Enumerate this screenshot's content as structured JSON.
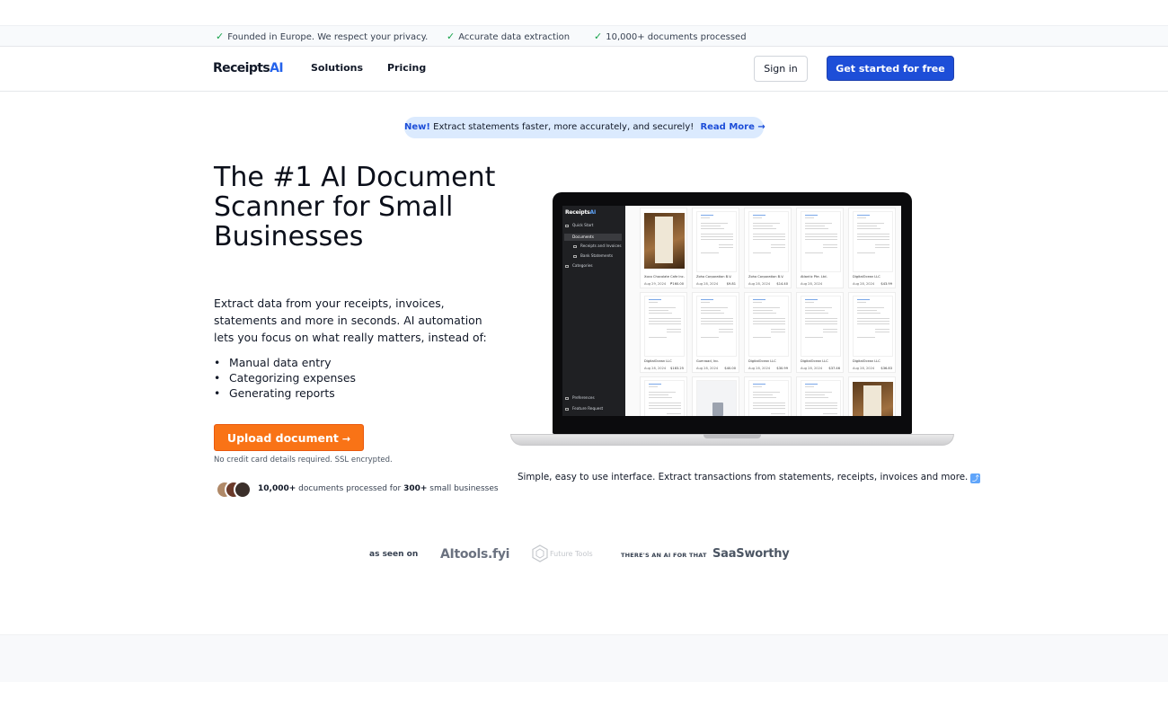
{
  "trust_bar": {
    "items": [
      {
        "icon": "check-icon",
        "text": "Founded in Europe. We respect your privacy."
      },
      {
        "icon": "check-icon",
        "text": "Accurate data extraction"
      },
      {
        "icon": "check-icon",
        "text": "10,000+ documents processed"
      }
    ]
  },
  "nav": {
    "logo_main": "Receipts",
    "logo_accent": "AI",
    "links": [
      "Solutions",
      "Pricing"
    ],
    "sign_in": "Sign in",
    "get_started": "Get started for free"
  },
  "announcement": {
    "badge": "New!",
    "text": "Extract statements faster, more accurately, and securely!",
    "link": "Read More →"
  },
  "hero": {
    "title": "The #1 AI Document Scanner for Small Businesses",
    "description": "Extract data from your receipts, invoices, statements and more in seconds. AI automation lets you focus on what really matters, instead of:",
    "bullets": [
      "Manual data entry",
      "Categorizing expenses",
      "Generating reports"
    ],
    "cta_label": "Upload document",
    "cta_icon": "arrow-right-icon",
    "note": "No credit card details required. SSL encrypted.",
    "social_count": "10,000+",
    "social_mid": "documents processed for",
    "social_count2": "300+",
    "social_end": "small businesses"
  },
  "preview": {
    "app_logo_main": "Receipts",
    "app_logo_accent": "AI",
    "sidebar": [
      {
        "label": "Quick Start",
        "icon": "home-icon",
        "active": false,
        "sub": false
      },
      {
        "label": "Documents",
        "icon": "folder-icon",
        "active": true,
        "sub": false
      },
      {
        "label": "Receipts and Invoices",
        "icon": "receipt-icon",
        "active": false,
        "sub": true
      },
      {
        "label": "Bank Statements",
        "icon": "bank-icon",
        "active": false,
        "sub": true
      },
      {
        "label": "Categories",
        "icon": "tag-icon",
        "active": false,
        "sub": false
      }
    ],
    "sidebar_bottom": [
      {
        "label": "Preferences",
        "icon": "gear-icon"
      },
      {
        "label": "Feature Request",
        "icon": "bulb-icon"
      }
    ],
    "documents": [
      {
        "name": "Xoco Chocolate Cafe Inc.",
        "date": "Aug 29, 2024",
        "amount": "₱160.00",
        "kind": "photo"
      },
      {
        "name": "Zoho Corporation B.V.",
        "date": "Aug 28, 2024",
        "amount": "$9.81",
        "kind": "paper"
      },
      {
        "name": "Zoho Corporation B.V.",
        "date": "Aug 28, 2024",
        "amount": "$14.40",
        "kind": "paper"
      },
      {
        "name": "Atlantic Pte. Ltd.",
        "date": "Aug 28, 2024",
        "amount": "",
        "kind": "paper"
      },
      {
        "name": "DigitalOcean LLC",
        "date": "Aug 28, 2024",
        "amount": "$43.99",
        "kind": "paper"
      },
      {
        "name": "DigitalOcean LLC",
        "date": "Aug 28, 2024",
        "amount": "$183.25",
        "kind": "paper"
      },
      {
        "name": "Gumroad, Inc.",
        "date": "Aug 28, 2024",
        "amount": "$40.00",
        "kind": "paper"
      },
      {
        "name": "DigitalOcean LLC",
        "date": "Aug 28, 2024",
        "amount": "$30.99",
        "kind": "paper"
      },
      {
        "name": "DigitalOcean LLC",
        "date": "Aug 28, 2024",
        "amount": "$37.46",
        "kind": "paper"
      },
      {
        "name": "DigitalOcean LLC",
        "date": "Aug 28, 2024",
        "amount": "$36.83",
        "kind": "paper"
      },
      {
        "name": "",
        "date": "",
        "amount": "",
        "kind": "paper"
      },
      {
        "name": "",
        "date": "",
        "amount": "",
        "kind": "file"
      },
      {
        "name": "",
        "date": "",
        "amount": "",
        "kind": "paper"
      },
      {
        "name": "",
        "date": "",
        "amount": "",
        "kind": "paper"
      },
      {
        "name": "",
        "date": "",
        "amount": "",
        "kind": "photo"
      }
    ],
    "caption": "Simple, easy to use interface. Extract transactions from statements, receipts, invoices and more."
  },
  "as_seen_on": {
    "label": "as seen on",
    "logos": [
      "AItools.fyi",
      "Future Tools",
      "THERE'S AN AI FOR THAT",
      "SaaSworthy"
    ]
  },
  "colors": {
    "brand_blue": "#1d4ed8",
    "cta_orange": "#f97316",
    "check_green": "#16a34a",
    "announce_bg": "#dbeafe"
  }
}
